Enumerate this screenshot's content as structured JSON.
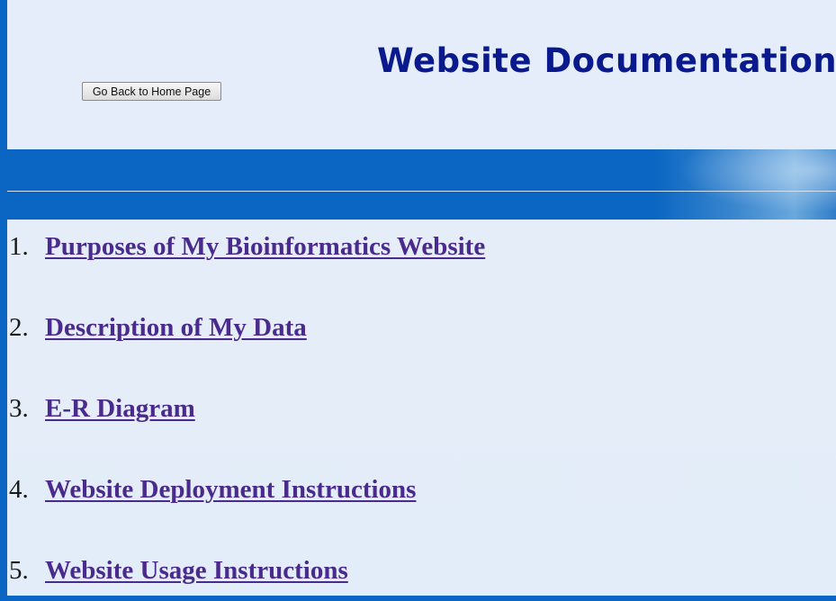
{
  "header": {
    "title": "Website Documentation",
    "back_button_label": "Go Back to Home Page"
  },
  "toc": {
    "items": [
      {
        "number": "1.",
        "label": "Purposes of My Bioinformatics Website"
      },
      {
        "number": "2.",
        "label": "Description of My Data"
      },
      {
        "number": "3.",
        "label": "E-R Diagram"
      },
      {
        "number": "4.",
        "label": "Website Deployment Instructions"
      },
      {
        "number": "5.",
        "label": "Website Usage Instructions"
      }
    ]
  },
  "colors": {
    "frame_blue": "#0a66c2",
    "title_blue": "#0a1a8c",
    "link_purple": "#4a2a8c",
    "background": "#e4edf9"
  }
}
